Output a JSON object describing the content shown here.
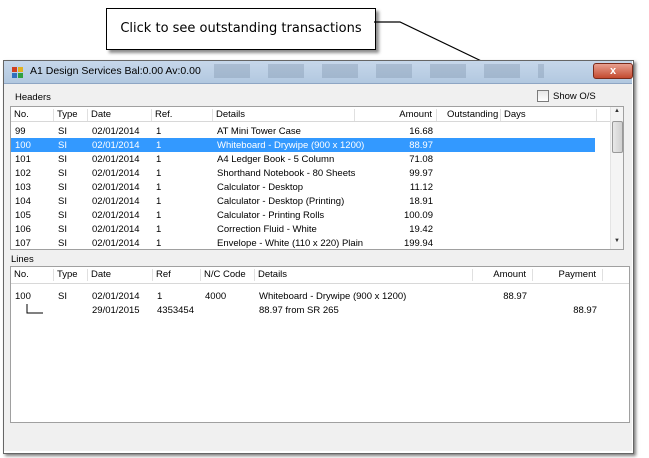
{
  "callout": {
    "text": "Click to see outstanding transactions"
  },
  "window": {
    "title": "A1 Design Services Bal:0.00 Av:0.00",
    "close_label": "x"
  },
  "headers_group": {
    "label": "Headers"
  },
  "show_os": {
    "label": "Show O/S",
    "checked": false
  },
  "headers_table": {
    "columns": [
      "No.",
      "Type",
      "Date",
      "Ref.",
      "Details",
      "Amount",
      "Outstanding",
      "Days"
    ],
    "rows": [
      [
        "99",
        "SI",
        "02/01/2014",
        "1",
        "AT Mini Tower Case",
        "16.68",
        "",
        ""
      ],
      [
        "100",
        "SI",
        "02/01/2014",
        "1",
        "Whiteboard - Drywipe (900 x 1200)",
        "88.97",
        "",
        ""
      ],
      [
        "101",
        "SI",
        "02/01/2014",
        "1",
        "A4 Ledger Book - 5 Column",
        "71.08",
        "",
        ""
      ],
      [
        "102",
        "SI",
        "02/01/2014",
        "1",
        "Shorthand Notebook - 80 Sheets",
        "99.97",
        "",
        ""
      ],
      [
        "103",
        "SI",
        "02/01/2014",
        "1",
        "Calculator - Desktop",
        "11.12",
        "",
        ""
      ],
      [
        "104",
        "SI",
        "02/01/2014",
        "1",
        "Calculator - Desktop (Printing)",
        "18.91",
        "",
        ""
      ],
      [
        "105",
        "SI",
        "02/01/2014",
        "1",
        "Calculator - Printing Rolls",
        "100.09",
        "",
        ""
      ],
      [
        "106",
        "SI",
        "02/01/2014",
        "1",
        "Correction Fluid - White",
        "19.42",
        "",
        ""
      ],
      [
        "107",
        "SI",
        "02/01/2014",
        "1",
        "Envelope - White (110 x 220) Plain",
        "199.94",
        "",
        ""
      ]
    ],
    "selected_row": 1
  },
  "lines_group": {
    "label": "Lines"
  },
  "lines_table": {
    "columns": [
      "No.",
      "Type",
      "Date",
      "Ref",
      "N/C Code",
      "Details",
      "Amount",
      "Payment"
    ],
    "rows": [
      [
        "100",
        "SI",
        "02/01/2014",
        "1",
        "4000",
        "Whiteboard - Drywipe (900 x 1200)",
        "88.97",
        ""
      ],
      [
        "",
        "",
        "29/01/2015",
        "4353454",
        "",
        "88.97 from SR 265",
        "",
        "88.97"
      ]
    ]
  }
}
